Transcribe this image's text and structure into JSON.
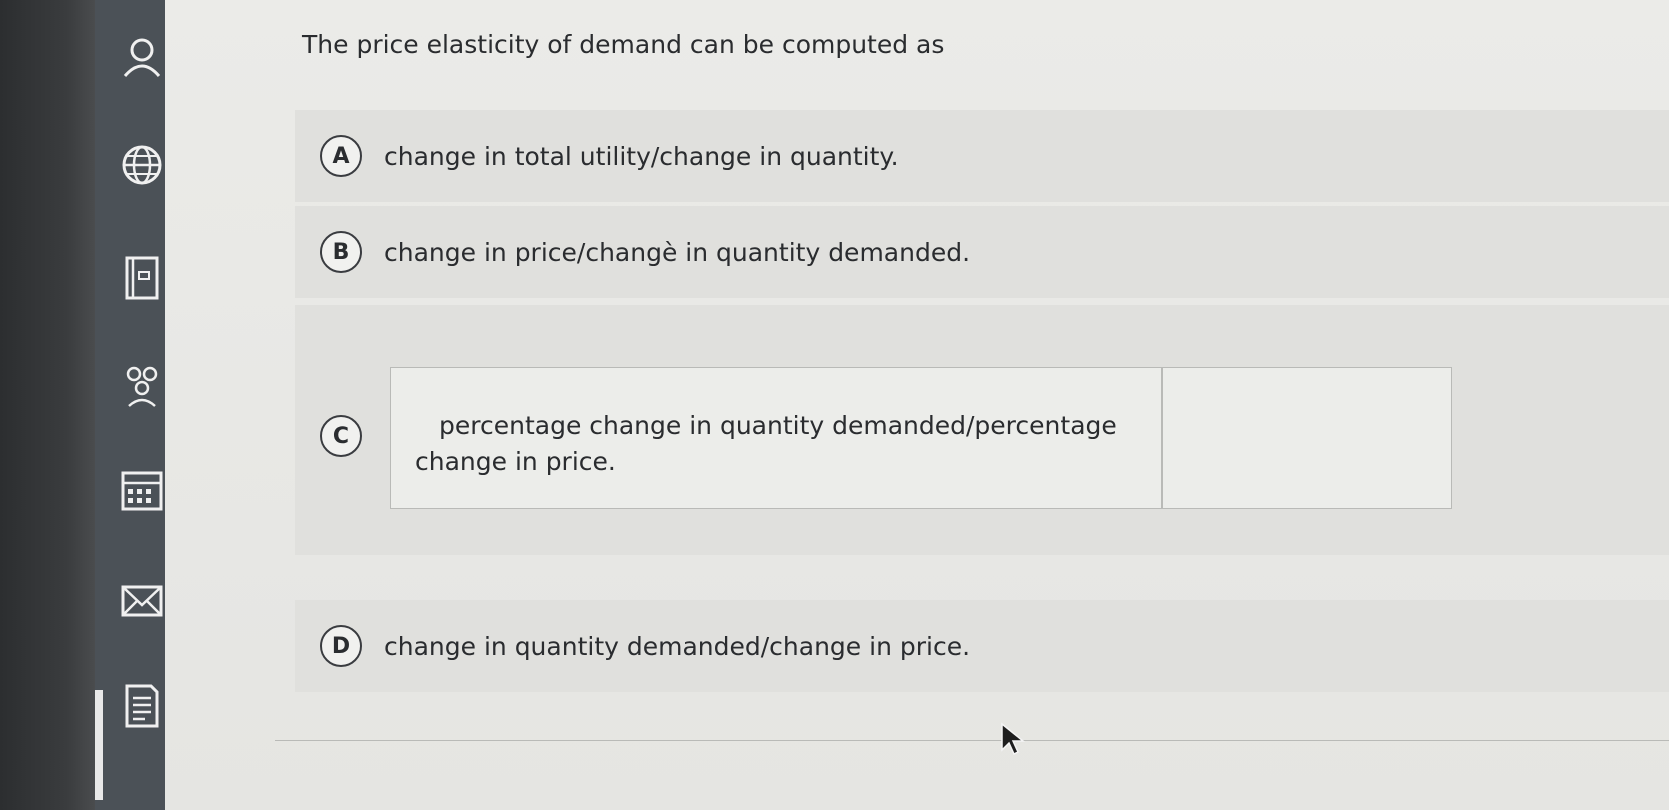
{
  "sidebar": {
    "icons": [
      "user-icon",
      "globe-icon",
      "book-icon",
      "people-icon",
      "calendar-icon",
      "mail-icon",
      "document-icon"
    ]
  },
  "question": {
    "text": "The price elasticity of demand can be computed as"
  },
  "options": [
    {
      "letter": "A",
      "text": "change in total utility/change in quantity."
    },
    {
      "letter": "B",
      "text": "change in price/changè in quantity demanded."
    },
    {
      "letter": "C",
      "text": "percentage change in quantity demanded/percentage change in price."
    },
    {
      "letter": "D",
      "text": "change in quantity demanded/change in price."
    }
  ]
}
